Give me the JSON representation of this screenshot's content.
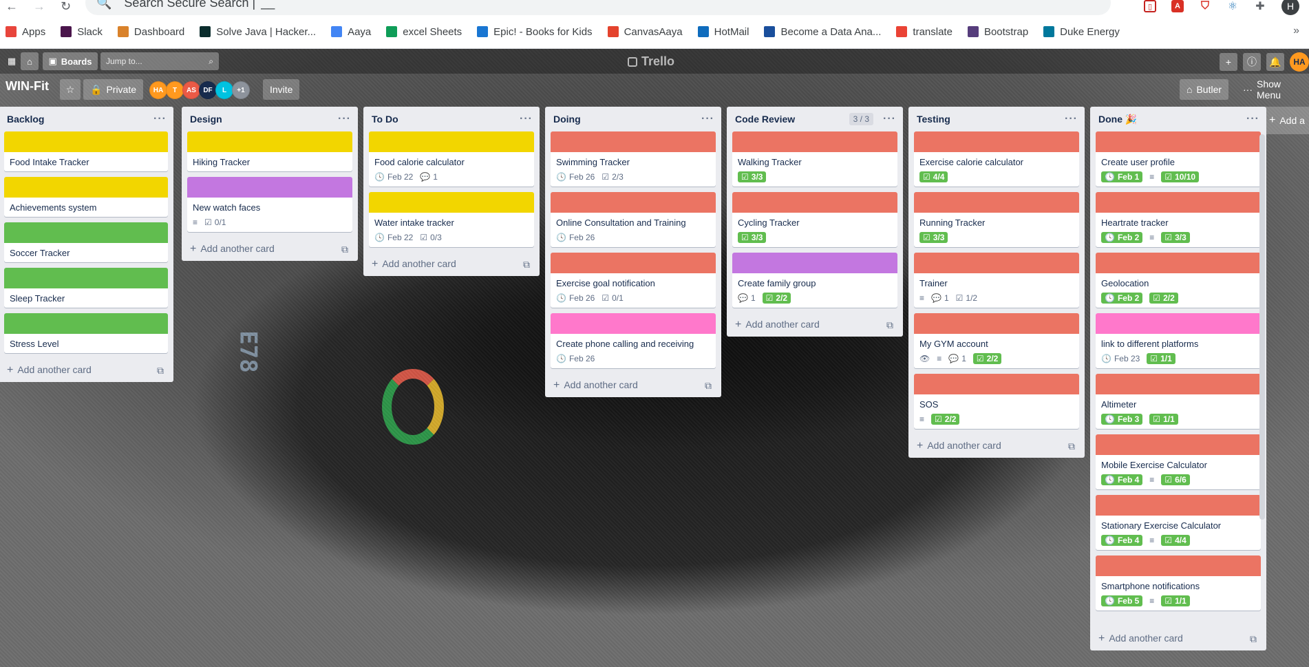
{
  "browser": {
    "search_placeholder": "Search Secure Search |",
    "search_value": "__",
    "bookmarks": [
      {
        "label": "Apps",
        "icon": "apps-grid-icon",
        "color": "#e8453c"
      },
      {
        "label": "Slack",
        "icon": "slack-icon",
        "color": "#4a154b"
      },
      {
        "label": "Dashboard",
        "icon": "dashboard-icon",
        "color": "#d9822b"
      },
      {
        "label": "Solve Java | Hacker...",
        "icon": "hackerrank-icon",
        "color": "#0b2d2d"
      },
      {
        "label": "Aaya",
        "icon": "docs-icon",
        "color": "#4285f4"
      },
      {
        "label": "excel Sheets",
        "icon": "sheets-icon",
        "color": "#0f9d58"
      },
      {
        "label": "Epic! - Books for Kids",
        "icon": "epic-icon",
        "color": "#1976d2"
      },
      {
        "label": "CanvasAaya",
        "icon": "canvas-icon",
        "color": "#e4432d"
      },
      {
        "label": "HotMail",
        "icon": "outlook-icon",
        "color": "#0f6cbd"
      },
      {
        "label": "Become a Data Ana...",
        "icon": "video-icon",
        "color": "#1a4f9c"
      },
      {
        "label": "translate",
        "icon": "google-icon",
        "color": "#ea4335"
      },
      {
        "label": "Bootstrap",
        "icon": "bootstrap-icon",
        "color": "#563d7c"
      },
      {
        "label": "Duke Energy",
        "icon": "duke-icon",
        "color": "#00789c"
      }
    ],
    "profile_initial": "H"
  },
  "trello": {
    "boards_label": "Boards",
    "jump_placeholder": "Jump to...",
    "logo": "Trello",
    "user_initials": "HA",
    "board_name": "WIN-Fit",
    "visibility": "Private",
    "members": [
      {
        "initials": "HA",
        "color": "#ff991f"
      },
      {
        "initials": "T",
        "color": "#ff991f"
      },
      {
        "initials": "AS",
        "color": "#eb5a46"
      },
      {
        "initials": "DF",
        "color": "#172b4d"
      },
      {
        "initials": "L",
        "color": "#00c2e0"
      },
      {
        "initials": "+1",
        "color": "#8d939c"
      }
    ],
    "invite": "Invite",
    "butler": "Butler",
    "show_menu": "Show Menu",
    "add_list": "Add a",
    "add_card": "Add another card"
  },
  "lists": [
    {
      "title": "Backlog",
      "cards": [
        {
          "title": "Food Intake Tracker",
          "label": "#f2d600",
          "badges": []
        },
        {
          "title": "Achievements system",
          "label": "#f2d600",
          "badges": []
        },
        {
          "title": "Soccer Tracker",
          "label": "#61bd4f",
          "badges": []
        },
        {
          "title": "Sleep Tracker",
          "label": "#61bd4f",
          "badges": []
        },
        {
          "title": "Stress Level",
          "label": "#61bd4f",
          "badges": []
        }
      ]
    },
    {
      "title": "Design",
      "cards": [
        {
          "title": "Hiking Tracker",
          "label": "#f2d600",
          "badges": []
        },
        {
          "title": "New watch faces",
          "label": "#c377e0",
          "badges": [
            {
              "type": "desc"
            },
            {
              "type": "check",
              "text": "0/1"
            }
          ]
        }
      ]
    },
    {
      "title": "To Do",
      "cards": [
        {
          "title": "Food calorie calculator",
          "label": "#f2d600",
          "badges": [
            {
              "type": "date",
              "text": "Feb 22"
            },
            {
              "type": "comment",
              "text": "1"
            }
          ]
        },
        {
          "title": "Water intake tracker",
          "label": "#f2d600",
          "badges": [
            {
              "type": "date",
              "text": "Feb 22"
            },
            {
              "type": "check",
              "text": "0/3"
            }
          ]
        }
      ]
    },
    {
      "title": "Doing",
      "cards": [
        {
          "title": "Swimming Tracker",
          "label": "#eb7463",
          "badges": [
            {
              "type": "date",
              "text": "Feb 26"
            },
            {
              "type": "check",
              "text": "2/3"
            }
          ]
        },
        {
          "title": "Online Consultation and Training",
          "label": "#eb7463",
          "badges": [
            {
              "type": "date",
              "text": "Feb 26"
            }
          ]
        },
        {
          "title": "Exercise goal notification",
          "label": "#eb7463",
          "badges": [
            {
              "type": "date",
              "text": "Feb 26"
            },
            {
              "type": "check",
              "text": "0/1"
            }
          ]
        },
        {
          "title": "Create phone calling and receiving",
          "label": "#ff78cb",
          "badges": [
            {
              "type": "date",
              "text": "Feb 26"
            }
          ]
        }
      ]
    },
    {
      "title": "Code Review",
      "count": "3 / 3",
      "cards": [
        {
          "title": "Walking Tracker",
          "label": "#eb7463",
          "badges": [
            {
              "type": "check-green",
              "text": "3/3"
            }
          ]
        },
        {
          "title": "Cycling Tracker",
          "label": "#eb7463",
          "badges": [
            {
              "type": "check-green",
              "text": "3/3"
            }
          ]
        },
        {
          "title": "Create family group",
          "label": "#c377e0",
          "badges": [
            {
              "type": "comment",
              "text": "1"
            },
            {
              "type": "check-green",
              "text": "2/2"
            }
          ]
        }
      ]
    },
    {
      "title": "Testing",
      "cards": [
        {
          "title": "Exercise calorie calculator",
          "label": "#eb7463",
          "badges": [
            {
              "type": "check-green",
              "text": "4/4"
            }
          ]
        },
        {
          "title": "Running Tracker",
          "label": "#eb7463",
          "badges": [
            {
              "type": "check-green",
              "text": "3/3"
            }
          ]
        },
        {
          "title": "Trainer",
          "label": "#eb7463",
          "badges": [
            {
              "type": "desc"
            },
            {
              "type": "comment",
              "text": "1"
            },
            {
              "type": "check",
              "text": "1/2"
            }
          ]
        },
        {
          "title": "My GYM account",
          "label": "#eb7463",
          "badges": [
            {
              "type": "watch"
            },
            {
              "type": "desc"
            },
            {
              "type": "comment",
              "text": "1"
            },
            {
              "type": "check-green",
              "text": "2/2"
            }
          ]
        },
        {
          "title": "SOS",
          "label": "#eb7463",
          "badges": [
            {
              "type": "desc"
            },
            {
              "type": "check-green",
              "text": "2/2"
            }
          ]
        }
      ]
    },
    {
      "title": "Done 🎉",
      "cards": [
        {
          "title": "Create user profile",
          "label": "#eb7463",
          "badges": [
            {
              "type": "date-green",
              "text": "Feb 1"
            },
            {
              "type": "desc"
            },
            {
              "type": "check-green",
              "text": "10/10"
            }
          ]
        },
        {
          "title": "Heartrate tracker",
          "label": "#eb7463",
          "badges": [
            {
              "type": "date-green",
              "text": "Feb 2"
            },
            {
              "type": "desc"
            },
            {
              "type": "check-green",
              "text": "3/3"
            }
          ]
        },
        {
          "title": "Geolocation",
          "label": "#eb7463",
          "badges": [
            {
              "type": "date-green",
              "text": "Feb 2"
            },
            {
              "type": "check-green",
              "text": "2/2"
            }
          ]
        },
        {
          "title": "link to different platforms",
          "label": "#ff78cb",
          "badges": [
            {
              "type": "date",
              "text": "Feb 23"
            },
            {
              "type": "check-green",
              "text": "1/1"
            }
          ]
        },
        {
          "title": "Altimeter",
          "label": "#eb7463",
          "badges": [
            {
              "type": "date-green",
              "text": "Feb 3"
            },
            {
              "type": "check-green",
              "text": "1/1"
            }
          ]
        },
        {
          "title": "Mobile Exercise Calculator",
          "label": "#eb7463",
          "badges": [
            {
              "type": "date-green",
              "text": "Feb 4"
            },
            {
              "type": "desc"
            },
            {
              "type": "check-green",
              "text": "6/6"
            }
          ]
        },
        {
          "title": "Stationary Exercise Calculator",
          "label": "#eb7463",
          "badges": [
            {
              "type": "date-green",
              "text": "Feb 4"
            },
            {
              "type": "desc"
            },
            {
              "type": "check-green",
              "text": "4/4"
            }
          ]
        },
        {
          "title": "Smartphone notifications",
          "label": "#eb7463",
          "badges": [
            {
              "type": "date-green",
              "text": "Feb 5"
            },
            {
              "type": "desc"
            },
            {
              "type": "check-green",
              "text": "1/1"
            }
          ]
        }
      ]
    }
  ]
}
